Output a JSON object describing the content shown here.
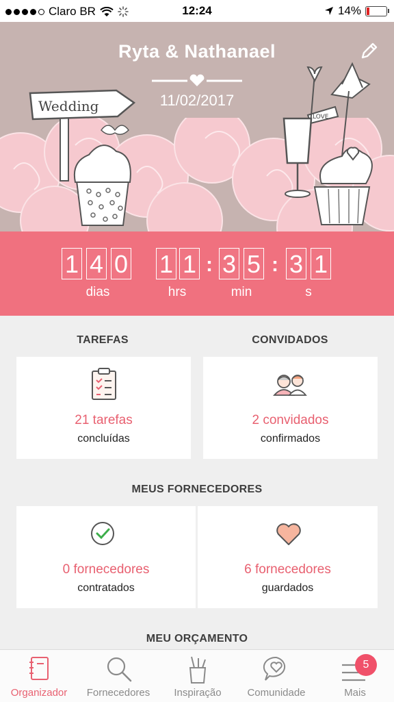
{
  "status_bar": {
    "carrier": "Claro BR",
    "time": "12:24",
    "battery": "14%",
    "battery_level": 0.14
  },
  "header": {
    "couple": "Ryta & Nathanael",
    "date": "11/02/2017",
    "sign_text": "Wedding",
    "flag_text": "LOVE"
  },
  "countdown": {
    "days": [
      "1",
      "4",
      "0"
    ],
    "hours": [
      "1",
      "1"
    ],
    "minutes": [
      "3",
      "5"
    ],
    "seconds": [
      "3",
      "1"
    ],
    "labels": {
      "days": "dias",
      "hours": "hrs",
      "minutes": "min",
      "seconds": "s"
    }
  },
  "tasks": {
    "title": "TAREFAS",
    "count": "21 tarefas",
    "status": "concluídas"
  },
  "guests": {
    "title": "CONVIDADOS",
    "count": "2 convidados",
    "status": "confirmados"
  },
  "vendors": {
    "title": "MEUS FORNECEDORES",
    "hired": {
      "count": "0 fornecedores",
      "status": "contratados"
    },
    "saved": {
      "count": "6 fornecedores",
      "status": "guardados"
    }
  },
  "budget": {
    "title": "MEU ORÇAMENTO"
  },
  "tabbar": {
    "items": [
      {
        "label": "Organizador",
        "icon": "notebook-icon"
      },
      {
        "label": "Fornecedores",
        "icon": "search-icon"
      },
      {
        "label": "Inspiração",
        "icon": "pencil-cup-icon"
      },
      {
        "label": "Comunidade",
        "icon": "chat-heart-icon"
      },
      {
        "label": "Mais",
        "icon": "menu-icon"
      }
    ],
    "badge": "5"
  },
  "colors": {
    "accent": "#f0717f",
    "accent_text": "#e86070",
    "hero_bg": "#c6b3b0",
    "rose": "#f6c9cf"
  }
}
